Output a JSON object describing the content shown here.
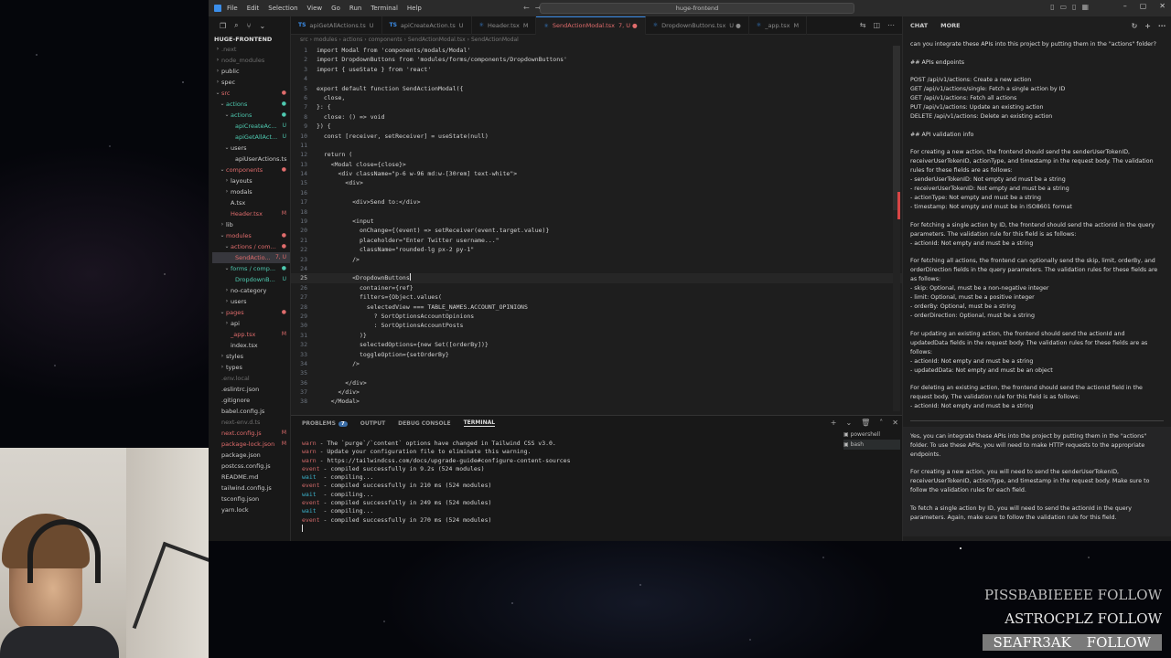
{
  "window": {
    "menu": [
      "File",
      "Edit",
      "Selection",
      "View",
      "Go",
      "Run",
      "Terminal",
      "Help"
    ],
    "search": "huge-frontend"
  },
  "explorer": {
    "root": "HUGE-FRONTEND",
    "items": [
      {
        "label": ".next",
        "depth": 1,
        "chev": "›",
        "color": "#6e6e6e",
        "badge": "",
        "badge_color": ""
      },
      {
        "label": "node_modules",
        "depth": 1,
        "chev": "›",
        "color": "#6e6e6e",
        "badge": "",
        "badge_color": ""
      },
      {
        "label": "public",
        "depth": 1,
        "chev": "›",
        "color": "#cccccc",
        "badge": "",
        "badge_color": ""
      },
      {
        "label": "spec",
        "depth": 1,
        "chev": "›",
        "color": "#cccccc",
        "badge": "",
        "badge_color": ""
      },
      {
        "label": "src",
        "depth": 1,
        "chev": "⌄",
        "color": "#e06c6c",
        "badge": "●",
        "badge_color": "#e06c6c"
      },
      {
        "label": "actions",
        "depth": 2,
        "chev": "⌄",
        "color": "#4ec9b0",
        "badge": "●",
        "badge_color": "#4ec9b0"
      },
      {
        "label": "actions",
        "depth": 3,
        "chev": "⌄",
        "color": "#4ec9b0",
        "badge": "●",
        "badge_color": "#4ec9b0"
      },
      {
        "label": "apiCreateAc...",
        "depth": 4,
        "chev": "",
        "color": "#4ec9b0",
        "badge": "U",
        "badge_color": "#4ec9b0"
      },
      {
        "label": "apiGetAllAct...",
        "depth": 4,
        "chev": "",
        "color": "#4ec9b0",
        "badge": "U",
        "badge_color": "#4ec9b0"
      },
      {
        "label": "users",
        "depth": 3,
        "chev": "⌄",
        "color": "#cccccc",
        "badge": "",
        "badge_color": ""
      },
      {
        "label": "apiUserActions.ts",
        "depth": 4,
        "chev": "",
        "color": "#cccccc",
        "badge": "",
        "badge_color": ""
      },
      {
        "label": "components",
        "depth": 2,
        "chev": "⌄",
        "color": "#e06c6c",
        "badge": "●",
        "badge_color": "#e06c6c"
      },
      {
        "label": "layouts",
        "depth": 3,
        "chev": "›",
        "color": "#cccccc",
        "badge": "",
        "badge_color": ""
      },
      {
        "label": "modals",
        "depth": 3,
        "chev": "›",
        "color": "#cccccc",
        "badge": "",
        "badge_color": ""
      },
      {
        "label": "A.tsx",
        "depth": 3,
        "chev": "",
        "color": "#cccccc",
        "badge": "",
        "badge_color": ""
      },
      {
        "label": "Header.tsx",
        "depth": 3,
        "chev": "",
        "color": "#e06c6c",
        "badge": "M",
        "badge_color": "#e06c6c"
      },
      {
        "label": "lib",
        "depth": 2,
        "chev": "›",
        "color": "#cccccc",
        "badge": "",
        "badge_color": ""
      },
      {
        "label": "modules",
        "depth": 2,
        "chev": "⌄",
        "color": "#e06c6c",
        "badge": "●",
        "badge_color": "#e06c6c"
      },
      {
        "label": "actions / com...",
        "depth": 3,
        "chev": "⌄",
        "color": "#e06c6c",
        "badge": "●",
        "badge_color": "#e06c6c"
      },
      {
        "label": "SendActio...",
        "depth": 4,
        "chev": "",
        "color": "#e06c6c",
        "badge": "7, U",
        "badge_color": "#e06c6c",
        "selected": true
      },
      {
        "label": "forms / comp...",
        "depth": 3,
        "chev": "⌄",
        "color": "#4ec9b0",
        "badge": "●",
        "badge_color": "#4ec9b0"
      },
      {
        "label": "DropdownB...",
        "depth": 4,
        "chev": "",
        "color": "#4ec9b0",
        "badge": "U",
        "badge_color": "#4ec9b0"
      },
      {
        "label": "no-category",
        "depth": 3,
        "chev": "›",
        "color": "#cccccc",
        "badge": "",
        "badge_color": ""
      },
      {
        "label": "users",
        "depth": 3,
        "chev": "›",
        "color": "#cccccc",
        "badge": "",
        "badge_color": ""
      },
      {
        "label": "pages",
        "depth": 2,
        "chev": "⌄",
        "color": "#e06c6c",
        "badge": "●",
        "badge_color": "#e06c6c"
      },
      {
        "label": "api",
        "depth": 3,
        "chev": "›",
        "color": "#cccccc",
        "badge": "",
        "badge_color": ""
      },
      {
        "label": "_app.tsx",
        "depth": 3,
        "chev": "",
        "color": "#e06c6c",
        "badge": "M",
        "badge_color": "#e06c6c"
      },
      {
        "label": "index.tsx",
        "depth": 3,
        "chev": "",
        "color": "#cccccc",
        "badge": "",
        "badge_color": ""
      },
      {
        "label": "styles",
        "depth": 2,
        "chev": "›",
        "color": "#cccccc",
        "badge": "",
        "badge_color": ""
      },
      {
        "label": "types",
        "depth": 2,
        "chev": "›",
        "color": "#cccccc",
        "badge": "",
        "badge_color": ""
      },
      {
        "label": ".env.local",
        "depth": 1,
        "chev": "",
        "color": "#6e6e6e",
        "badge": "",
        "badge_color": ""
      },
      {
        "label": ".eslintrc.json",
        "depth": 1,
        "chev": "",
        "color": "#cccccc",
        "badge": "",
        "badge_color": ""
      },
      {
        "label": ".gitignore",
        "depth": 1,
        "chev": "",
        "color": "#cccccc",
        "badge": "",
        "badge_color": ""
      },
      {
        "label": "babel.config.js",
        "depth": 1,
        "chev": "",
        "color": "#cccccc",
        "badge": "",
        "badge_color": ""
      },
      {
        "label": "next-env.d.ts",
        "depth": 1,
        "chev": "",
        "color": "#6e6e6e",
        "badge": "",
        "badge_color": ""
      },
      {
        "label": "next.config.js",
        "depth": 1,
        "chev": "",
        "color": "#e06c6c",
        "badge": "M",
        "badge_color": "#e06c6c"
      },
      {
        "label": "package-lock.json",
        "depth": 1,
        "chev": "",
        "color": "#e06c6c",
        "badge": "M",
        "badge_color": "#e06c6c"
      },
      {
        "label": "package.json",
        "depth": 1,
        "chev": "",
        "color": "#cccccc",
        "badge": "",
        "badge_color": ""
      },
      {
        "label": "postcss.config.js",
        "depth": 1,
        "chev": "",
        "color": "#cccccc",
        "badge": "",
        "badge_color": ""
      },
      {
        "label": "README.md",
        "depth": 1,
        "chev": "",
        "color": "#cccccc",
        "badge": "",
        "badge_color": ""
      },
      {
        "label": "tailwind.config.js",
        "depth": 1,
        "chev": "",
        "color": "#cccccc",
        "badge": "",
        "badge_color": ""
      },
      {
        "label": "tsconfig.json",
        "depth": 1,
        "chev": "",
        "color": "#cccccc",
        "badge": "",
        "badge_color": ""
      },
      {
        "label": "yarn.lock",
        "depth": 1,
        "chev": "",
        "color": "#cccccc",
        "badge": "",
        "badge_color": ""
      }
    ]
  },
  "tabs": [
    {
      "icon": "TS",
      "label": "apiGetAllActions.ts",
      "suffix": "U",
      "active": false
    },
    {
      "icon": "TS",
      "label": "apiCreateAction.ts",
      "suffix": "U",
      "active": false
    },
    {
      "icon": "⚛",
      "label": "Header.tsx",
      "suffix": "M",
      "active": false
    },
    {
      "icon": "⚛",
      "label": "SendActionModal.tsx",
      "suffix": "7, U ●",
      "active": true
    },
    {
      "icon": "⚛",
      "label": "DropdownButtons.tsx",
      "suffix": "U ●",
      "active": false
    },
    {
      "icon": "⚛",
      "label": "_app.tsx",
      "suffix": "M",
      "active": false
    }
  ],
  "breadcrumb": "src › modules › actions › components › SendActionModal.tsx › SendActionModal",
  "code": {
    "current_line": 25,
    "lines": [
      {
        "n": 1,
        "t": "import Modal from 'components/modals/Modal'"
      },
      {
        "n": 2,
        "t": "import DropdownButtons from 'modules/forms/components/DropdownButtons'"
      },
      {
        "n": 3,
        "t": "import { useState } from 'react'"
      },
      {
        "n": 4,
        "t": ""
      },
      {
        "n": 5,
        "t": "export default function SendActionModal({"
      },
      {
        "n": 6,
        "t": "  close,"
      },
      {
        "n": 7,
        "t": "}: {"
      },
      {
        "n": 8,
        "t": "  close: () => void"
      },
      {
        "n": 9,
        "t": "}) {"
      },
      {
        "n": 10,
        "t": "  const [receiver, setReceiver] = useState(null)"
      },
      {
        "n": 11,
        "t": ""
      },
      {
        "n": 12,
        "t": "  return ("
      },
      {
        "n": 13,
        "t": "    <Modal close={close}>"
      },
      {
        "n": 14,
        "t": "      <div className=\"p-6 w-96 md:w-[30rem] text-white\">"
      },
      {
        "n": 15,
        "t": "        <div>"
      },
      {
        "n": 16,
        "t": ""
      },
      {
        "n": 17,
        "t": "          <div>Send to:</div>"
      },
      {
        "n": 18,
        "t": ""
      },
      {
        "n": 19,
        "t": "          <input"
      },
      {
        "n": 20,
        "t": "            onChange={(event) => setReceiver(event.target.value)}"
      },
      {
        "n": 21,
        "t": "            placeholder=\"Enter Twitter username...\""
      },
      {
        "n": 22,
        "t": "            className=\"rounded-lg px-2 py-1\""
      },
      {
        "n": 23,
        "t": "          />"
      },
      {
        "n": 24,
        "t": ""
      },
      {
        "n": 25,
        "t": "          <DropdownButtons"
      },
      {
        "n": 26,
        "t": "            container={ref}"
      },
      {
        "n": 27,
        "t": "            filters={Object.values("
      },
      {
        "n": 28,
        "t": "              selectedView === TABLE_NAMES.ACCOUNT_OPINIONS"
      },
      {
        "n": 29,
        "t": "                ? SortOptionsAccountOpinions"
      },
      {
        "n": 30,
        "t": "                : SortOptionsAccountPosts"
      },
      {
        "n": 31,
        "t": "            )}"
      },
      {
        "n": 32,
        "t": "            selectedOptions={new Set([orderBy])}"
      },
      {
        "n": 33,
        "t": "            toggleOption={setOrderBy}"
      },
      {
        "n": 34,
        "t": "          />"
      },
      {
        "n": 35,
        "t": ""
      },
      {
        "n": 36,
        "t": "        </div>"
      },
      {
        "n": 37,
        "t": "      </div>"
      },
      {
        "n": 38,
        "t": "    </Modal>"
      }
    ]
  },
  "panel": {
    "tabs": [
      "PROBLEMS",
      "OUTPUT",
      "DEBUG CONSOLE",
      "TERMINAL"
    ],
    "problems_count": "7",
    "active": "TERMINAL",
    "terminal_lines": [
      {
        "lvl": "warn",
        "msg": " - The `purge`/`content` options have changed in Tailwind CSS v3.0."
      },
      {
        "lvl": "warn",
        "msg": " - Update your configuration file to eliminate this warning."
      },
      {
        "lvl": "warn",
        "msg": " - https://tailwindcss.com/docs/upgrade-guide#configure-content-sources"
      },
      {
        "lvl": "event",
        "msg": " - compiled successfully in 9.2s (524 modules)"
      },
      {
        "lvl": "wait",
        "msg": "  - compiling..."
      },
      {
        "lvl": "event",
        "msg": " - compiled successfully in 210 ms (524 modules)"
      },
      {
        "lvl": "wait",
        "msg": "  - compiling..."
      },
      {
        "lvl": "event",
        "msg": " - compiled successfully in 249 ms (524 modules)"
      },
      {
        "lvl": "wait",
        "msg": "  - compiling..."
      },
      {
        "lvl": "event",
        "msg": " - compiled successfully in 270 ms (524 modules)"
      }
    ],
    "terminals": [
      "powershell",
      "bash"
    ]
  },
  "chat": {
    "tabs": [
      "CHAT",
      "MORE"
    ],
    "question": "can you integrate these APIs into this project by putting them in the \"actions\" folder?",
    "paragraphs": [
      "## APIs endpoints",
      "POST /api/v1/actions: Create a new action\nGET /api/v1/actions/single: Fetch a single action by ID\nGET /api/v1/actions: Fetch all actions\nPUT /api/v1/actions: Update an existing action\nDELETE /api/v1/actions: Delete an existing action",
      "## API validation info",
      "For creating a new action, the frontend should send the senderUserTokenID, receiverUserTokenID, actionType, and timestamp in the request body. The validation rules for these fields are as follows:\n- senderUserTokenID: Not empty and must be a string\n- receiverUserTokenID: Not empty and must be a string\n- actionType: Not empty and must be a string\n- timestamp: Not empty and must be in ISO8601 format",
      "For fetching a single action by ID, the frontend should send the actionId in the query parameters. The validation rule for this field is as follows:\n- actionId: Not empty and must be a string",
      "For fetching all actions, the frontend can optionally send the skip, limit, orderBy, and orderDirection fields in the query parameters. The validation rules for these fields are as follows:\n- skip: Optional, must be a non-negative integer\n- limit: Optional, must be a positive integer\n- orderBy: Optional, must be a string\n- orderDirection: Optional, must be a string",
      "For updating an existing action, the frontend should send the actionId and updatedData fields in the request body. The validation rules for these fields are as follows:\n- actionId: Not empty and must be a string\n- updatedData: Not empty and must be an object",
      "For deleting an existing action, the frontend should send the actionId field in the request body. The validation rule for this field is as follows:\n- actionId: Not empty and must be a string"
    ],
    "response": [
      "Yes, you can integrate these APIs into the project by putting them in the \"actions\" folder. To use these APIs, you will need to make HTTP requests to the appropriate endpoints.",
      "For creating a new action, you will need to send the senderUserTokenID, receiverUserTokenID, actionType, and timestamp in the request body. Make sure to follow the validation rules for each field.",
      "To fetch a single action by ID, you will need to send the actionId in the query parameters. Again, make sure to follow the validation rule for this field."
    ]
  },
  "overlay": {
    "follows": [
      {
        "name": "PISSBABIEEEE",
        "action": "FOLLOW",
        "style": "dim"
      },
      {
        "name": "ASTROCPLZ",
        "action": "FOLLOW",
        "style": "normal"
      },
      {
        "name": "SEAFR3AK",
        "action": "FOLLOW",
        "style": "hl"
      }
    ]
  }
}
